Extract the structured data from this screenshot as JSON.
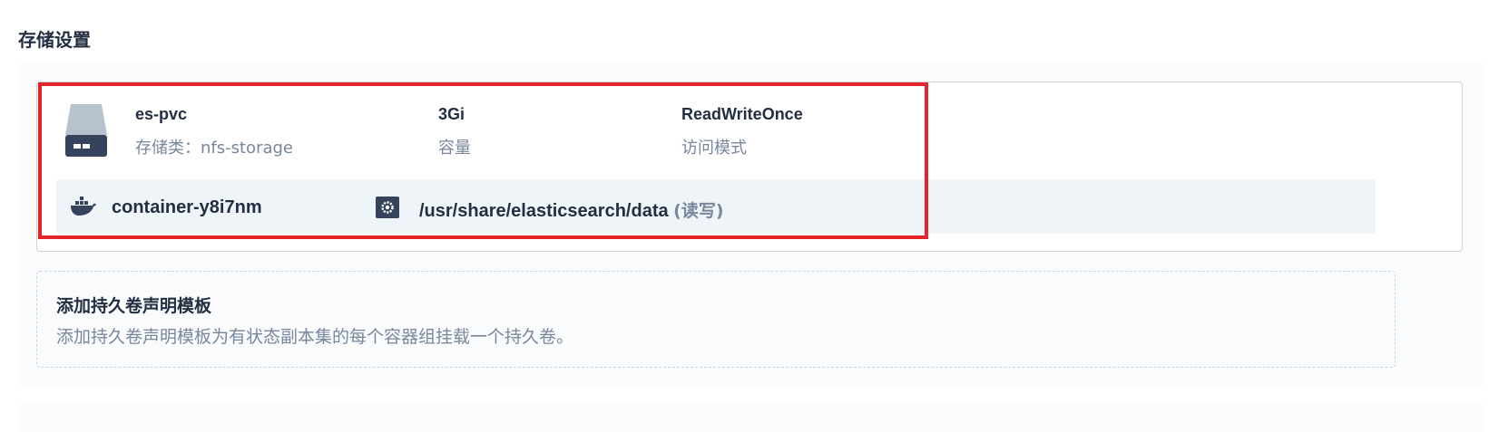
{
  "section": {
    "title": "存储设置"
  },
  "volume": {
    "name": "es-pvc",
    "storage_class_label": "存储类：nfs-storage",
    "capacity": "3Gi",
    "capacity_label": "容量",
    "access_mode": "ReadWriteOnce",
    "access_mode_label": "访问模式",
    "icon": "disk-icon",
    "mount": {
      "container_icon": "docker-icon",
      "container": "container-y8i7nm",
      "path_icon": "gear-icon",
      "path": "/usr/share/elasticsearch/data",
      "mode": "(读写)"
    }
  },
  "add_template": {
    "title": "添加持久卷声明模板",
    "description": "添加持久卷声明模板为有状态副本集的每个容器组挂载一个持久卷。"
  },
  "colors": {
    "highlight": "#e3242b",
    "text_primary": "#242e42",
    "text_secondary": "#79879c",
    "panel_bg": "#f9fbfd",
    "mount_bg": "#eff4f9"
  }
}
